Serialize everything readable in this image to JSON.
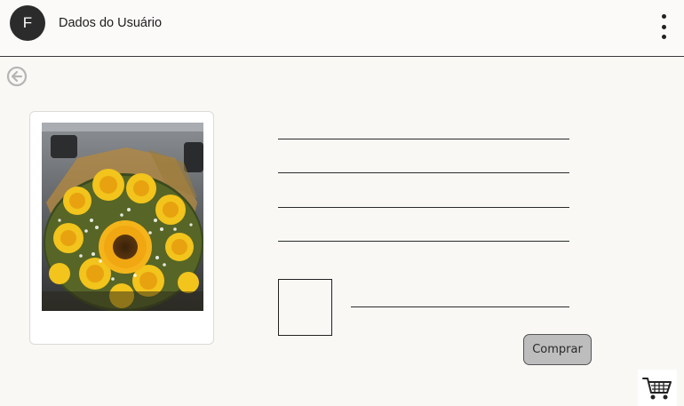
{
  "header": {
    "avatar_initial": "F",
    "title": "Dados do Usuário"
  },
  "icons": {
    "menu": "more-vertical-icon",
    "back": "arrow-left-circle-icon",
    "cart": "shopping-cart-icon",
    "photo": "sunflower-bouquet-image"
  },
  "form": {
    "buy_label": "Comprar"
  },
  "colors": {
    "background": "#f9f8f5",
    "avatar": "#2b2b2b",
    "button": "#bdbdbd"
  }
}
